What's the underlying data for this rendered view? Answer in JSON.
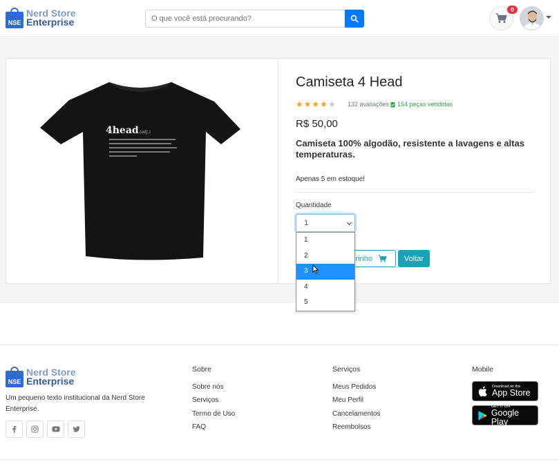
{
  "header": {
    "logo_badge": "NSE",
    "logo_line1": "Nerd Store",
    "logo_line2": "Enterprise",
    "search_placeholder": "O que você está procurando?",
    "cart_count": "0"
  },
  "product": {
    "title": "Camiseta 4 Head",
    "rating": 4,
    "max_rating": 5,
    "reviews": "132 avaliações",
    "sold": "154 peças vendidas",
    "price": "R$ 50,00",
    "description": "Camiseta 100% algodão, resistente a lavagens e altas temperaturas.",
    "stock": "Apenas 5 em estoque!",
    "quantity_label": "Quantidade",
    "quantity_value": "1",
    "quantity_options": [
      "1",
      "2",
      "3",
      "4",
      "5"
    ],
    "quantity_highlighted": "3",
    "add_cart_label": "rinho",
    "back_label": "Voltar",
    "shirt_print_title": "4head",
    "shirt_print_sub": "(adj.)"
  },
  "footer": {
    "logo_badge": "NSE",
    "logo_line1": "Nerd Store",
    "logo_line2": "Enterprise",
    "text": "Um pequeno texto institucional da Nerd Store Enterprise.",
    "col_sobre": {
      "title": "Sobre",
      "links": [
        "Sobre nós",
        "Serviços",
        "Termo de Uso",
        "FAQ"
      ]
    },
    "col_servicos": {
      "title": "Serviços",
      "links": [
        "Meus Pedidos",
        "Meu Perfil",
        "Cancelamentos",
        "Reembolsos"
      ]
    },
    "col_mobile": {
      "title": "Mobile",
      "appstore_small": "Download on the",
      "appstore_big": "App Store",
      "play_small": "GET IT ON",
      "play_big": "Google Play"
    }
  },
  "colors": {
    "brand": "#2e6bd1",
    "primary": "#007bff",
    "info": "#17a2b8",
    "star": "#f0a31c",
    "success": "#28a745",
    "badge": "#dc3545"
  }
}
